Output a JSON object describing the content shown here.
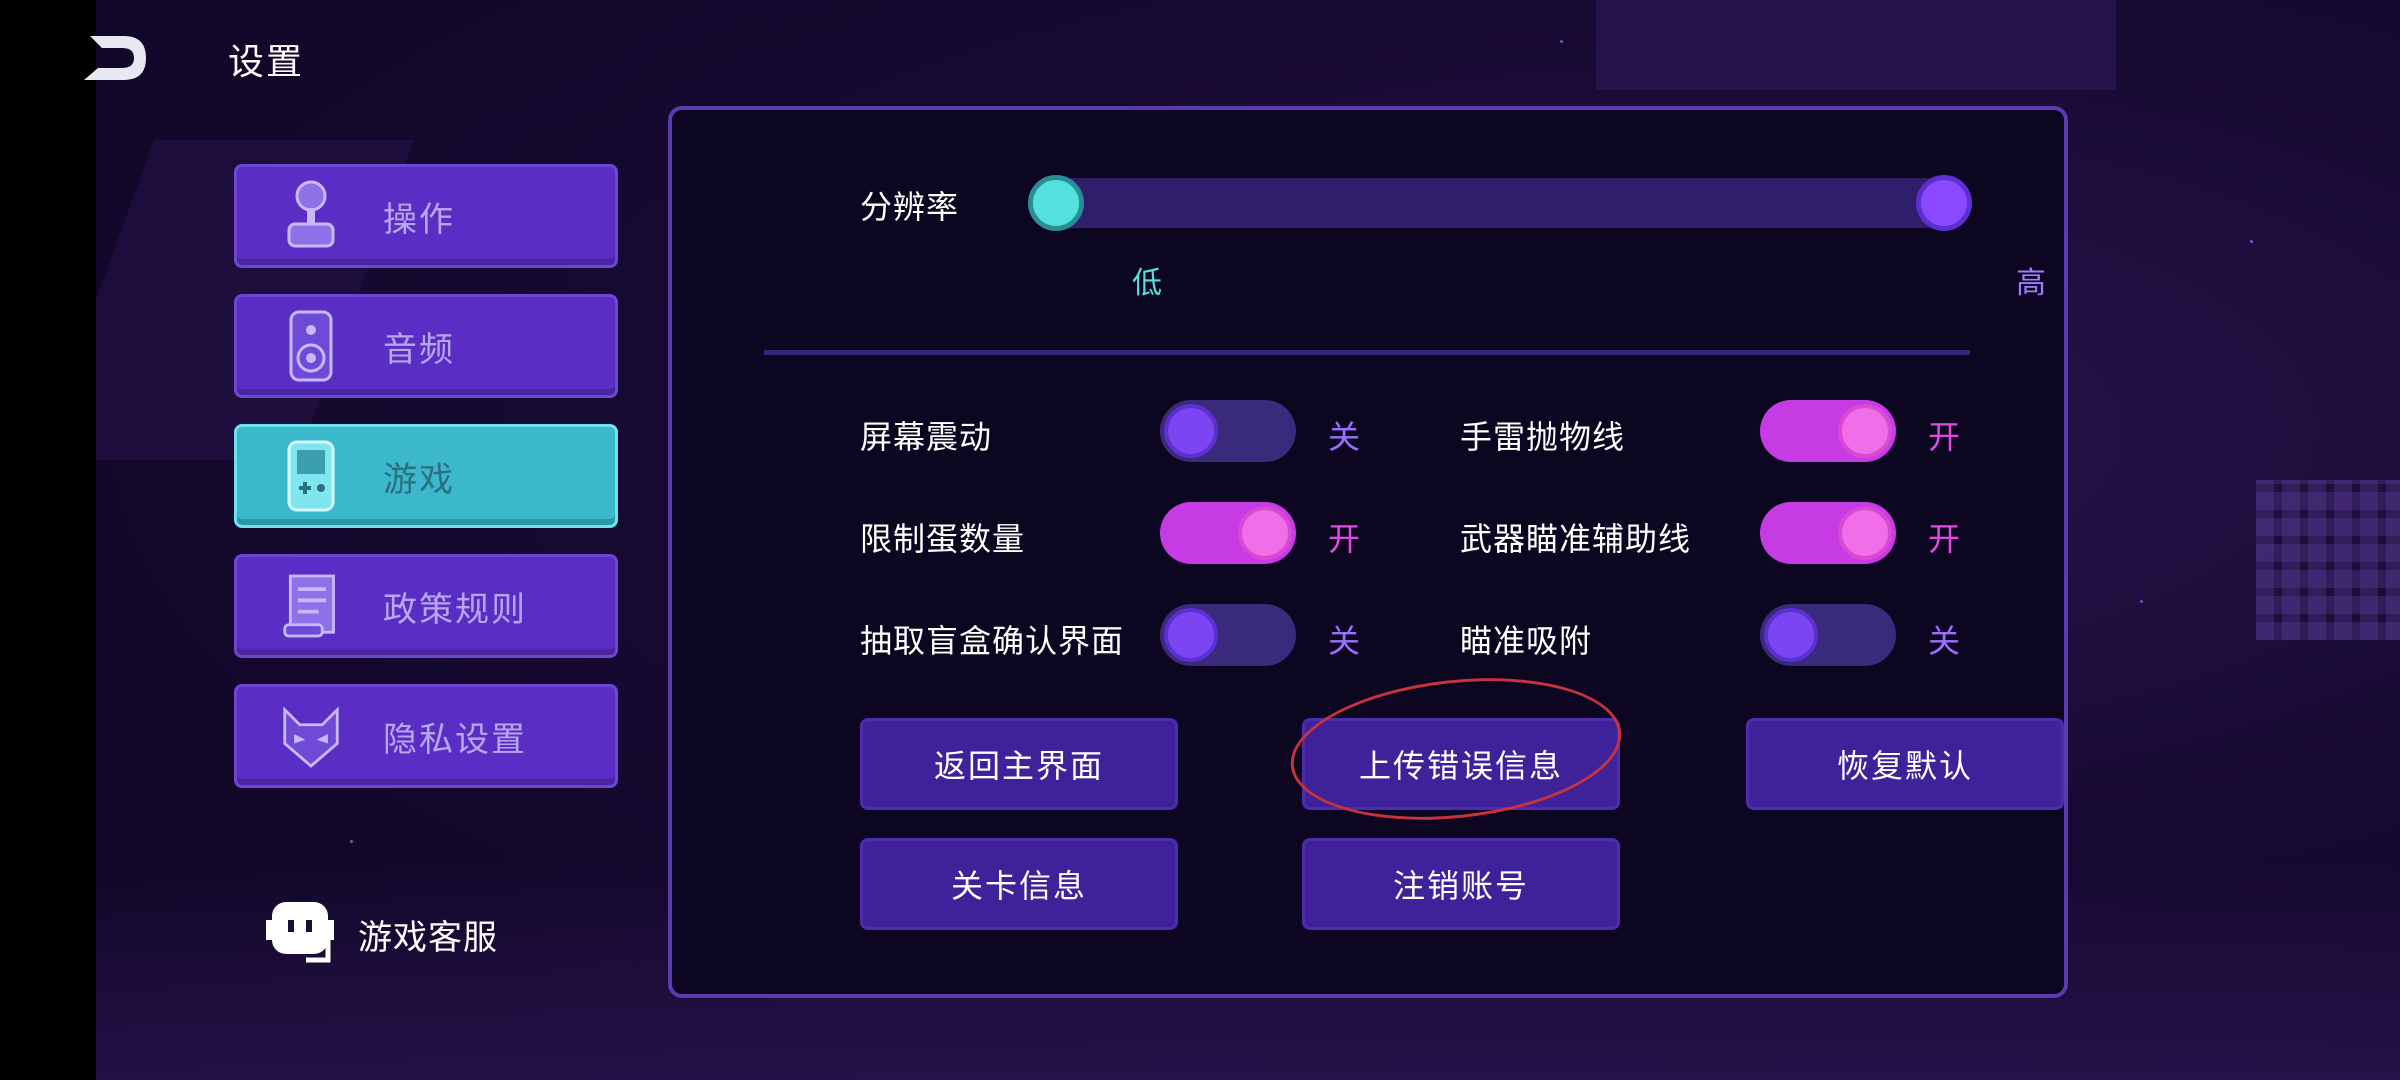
{
  "header": {
    "title": "设置"
  },
  "sidebar": {
    "items": [
      {
        "label": "操作",
        "icon": "joystick-icon"
      },
      {
        "label": "音频",
        "icon": "speaker-icon"
      },
      {
        "label": "游戏",
        "icon": "gameboy-icon"
      },
      {
        "label": "政策规则",
        "icon": "scroll-icon"
      },
      {
        "label": "隐私设置",
        "icon": "mask-icon"
      }
    ],
    "active": "游戏",
    "service_label": "游戏客服"
  },
  "resolution": {
    "label": "分辨率",
    "low_label": "低",
    "high_label": "高"
  },
  "toggles": [
    {
      "label": "屏幕震动",
      "state": "关",
      "on": false
    },
    {
      "label": "手雷抛物线",
      "state": "开",
      "on": true
    },
    {
      "label": "限制蛋数量",
      "state": "开",
      "on": true
    },
    {
      "label": "武器瞄准辅助线",
      "state": "开",
      "on": true
    },
    {
      "label": "抽取盲盒确认界面",
      "state": "关",
      "on": false
    },
    {
      "label": "瞄准吸附",
      "state": "关",
      "on": false
    }
  ],
  "buttons": {
    "back_main": "返回主界面",
    "upload_error": "上传错误信息",
    "restore_default": "恢复默认",
    "level_info": "关卡信息",
    "delete_account": "注销账号"
  },
  "colors": {
    "accent_purple": "#5a2ec4",
    "accent_cyan": "#3bb8cc",
    "toggle_on": "#c73be4",
    "annotation_red": "#c7323e"
  }
}
